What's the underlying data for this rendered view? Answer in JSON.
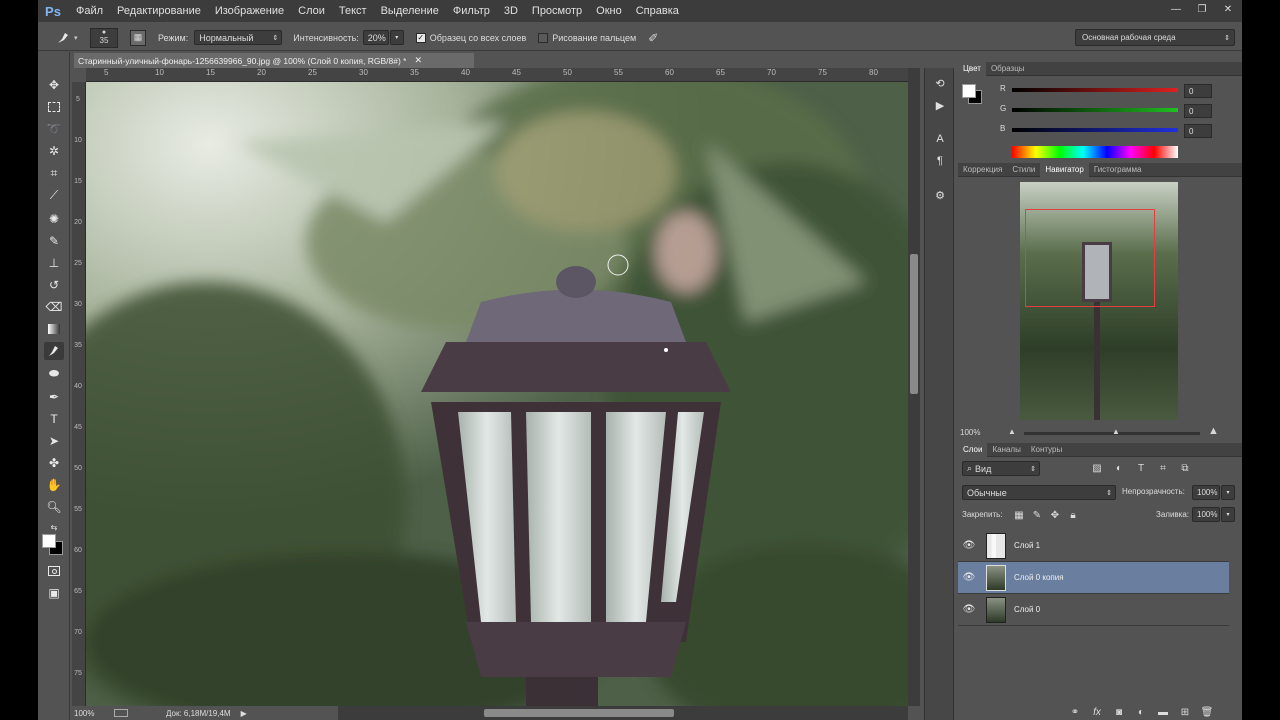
{
  "app": {
    "logo": "Ps"
  },
  "menu": [
    "Файл",
    "Редактирование",
    "Изображение",
    "Слои",
    "Текст",
    "Выделение",
    "Фильтр",
    "3D",
    "Просмотр",
    "Окно",
    "Справка"
  ],
  "window_controls": {
    "minimize": "—",
    "restore": "❐",
    "close": "✕"
  },
  "options": {
    "brush_size": "35",
    "mode_label": "Режим:",
    "mode_value": "Нормальный",
    "strength_label": "Интенсивность:",
    "strength_value": "20%",
    "sample_all_label": "Образец со всех слоев",
    "sample_all_checked": true,
    "finger_label": "Рисование пальцем",
    "finger_checked": false
  },
  "workspace": "Основная рабочая среда",
  "document": {
    "tab_title": "Старинный-уличный-фонарь-1256639966_90.jpg @ 100% (Слой 0 копия, RGB/8#) *",
    "ruler_h": [
      "5",
      "10",
      "15",
      "20",
      "25",
      "30",
      "35",
      "40",
      "45",
      "50",
      "55",
      "60",
      "65",
      "70",
      "75",
      "80"
    ],
    "ruler_v": [
      "5",
      "10",
      "15",
      "20",
      "25",
      "30",
      "35",
      "40",
      "45",
      "50",
      "55",
      "60",
      "65",
      "70",
      "75"
    ],
    "zoom": "100%",
    "doc_info": "Док: 6,18M/19,4M"
  },
  "color_panel": {
    "tabs": [
      "Цвет",
      "Образцы"
    ],
    "channels": [
      {
        "label": "R",
        "value": "0",
        "color": "#d02020"
      },
      {
        "label": "G",
        "value": "0",
        "color": "#20b020"
      },
      {
        "label": "B",
        "value": "0",
        "color": "#2030d0"
      }
    ]
  },
  "navigator_panel": {
    "tabs": [
      "Коррекция",
      "Стили",
      "Навигатор",
      "Гистограмма"
    ],
    "zoom": "100%"
  },
  "layers_panel": {
    "tabs": [
      "Слои",
      "Каналы",
      "Контуры"
    ],
    "filter_kind": "Вид",
    "blend_mode": "Обычные",
    "opacity_label": "Непрозрачность:",
    "opacity_value": "100%",
    "lock_label": "Закрепить:",
    "fill_label": "Заливка:",
    "fill_value": "100%",
    "layers": [
      {
        "name": "Слой 1",
        "selected": false
      },
      {
        "name": "Слой 0 копия",
        "selected": true
      },
      {
        "name": "Слой 0",
        "selected": false
      }
    ]
  },
  "colors": {
    "selected_layer": "#6a7fa0",
    "accent": "#e04040"
  }
}
